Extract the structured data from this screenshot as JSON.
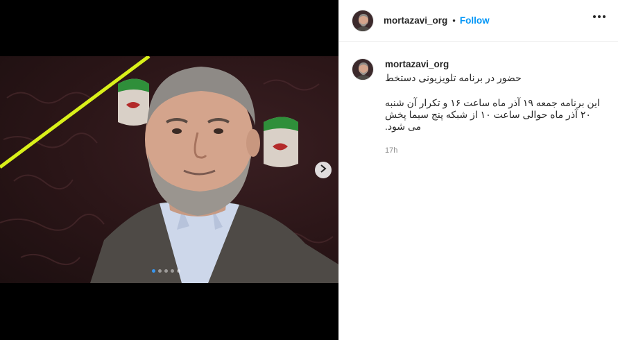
{
  "post": {
    "username": "mortazavi_org",
    "separator": "•",
    "follow_label": "Follow",
    "more_icon": "more-horizontal-icon"
  },
  "media": {
    "slide_count": 5,
    "current_slide": 1,
    "next_icon": "chevron-right-icon"
  },
  "caption": {
    "username": "mortazavi_org",
    "title": "حضور در برنامه تلویزیونی دستخط",
    "body": "این برنامه جمعه ۱۹ آذر ماه ساعت ۱۶ و تکرار آن شنبه ۲۰ آذر ماه حوالی ساعت ۱۰ از شبکه پنج سیما پخش می شود.",
    "time": "17h"
  },
  "colors": {
    "follow": "#0095f6",
    "active_dot": "#3897f0",
    "highlight_line": "#d9f01a"
  }
}
